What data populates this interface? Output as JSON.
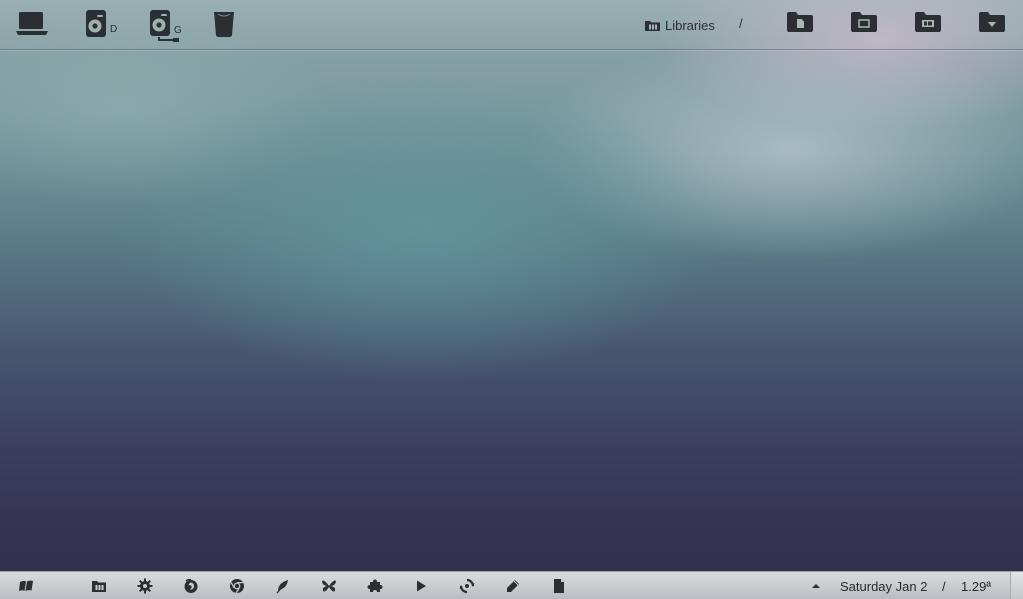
{
  "top_bar": {
    "devices": [
      {
        "icon": "laptop-icon",
        "letter": ""
      },
      {
        "icon": "drive-d-icon",
        "letter": "D"
      },
      {
        "icon": "drive-g-icon",
        "letter": "G"
      },
      {
        "icon": "trash-icon",
        "letter": ""
      }
    ],
    "breadcrumb": {
      "icon": "libraries-icon",
      "label": "Libraries",
      "separator": "/"
    },
    "folders": [
      "documents-folder-icon",
      "pictures-folder-icon",
      "videos-folder-icon",
      "downloads-folder-icon"
    ]
  },
  "panel": {
    "launchers": [
      "start-icon",
      "file-manager-icon",
      "settings-icon",
      "firefox-icon",
      "chrome-icon",
      "feather-icon",
      "butterfly-icon",
      "puzzle-icon",
      "play-icon",
      "sync-icon",
      "pen-icon",
      "document-icon"
    ],
    "tray_icon": "tray-expand-icon",
    "date": "Saturday Jan 2",
    "time_separator": "/",
    "time": "1.29ª"
  },
  "colors": {
    "icon": "#2b2f34",
    "panel_bg": "#c8cccf",
    "wallpaper_teal": "#62969e",
    "wallpaper_purple": "#2f2c48"
  }
}
